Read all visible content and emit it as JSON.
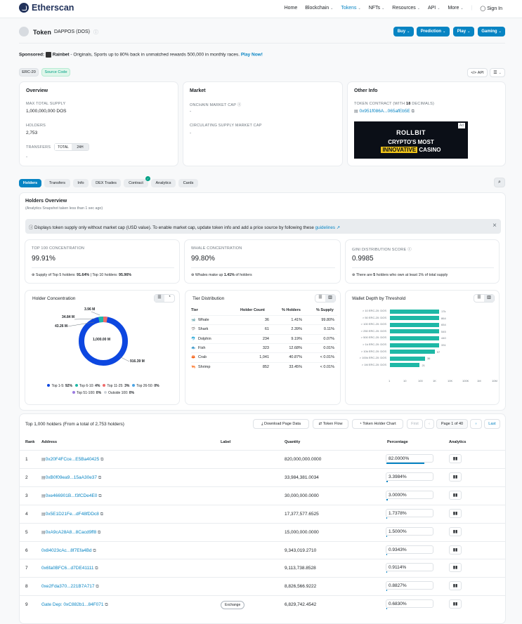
{
  "nav": {
    "brand": "Etherscan",
    "items": [
      "Home",
      "Blockchain",
      "Tokens",
      "NFTs",
      "Resources",
      "API",
      "More"
    ],
    "sign_in": "Sign In"
  },
  "token": {
    "label": "Token",
    "name": "DAPPOS (DOS)"
  },
  "header_buttons": [
    "Buy",
    "Prediction",
    "Play",
    "Gaming"
  ],
  "sponsored": {
    "prefix": "Sponsored:",
    "brand": "Rainbet",
    "text": "- Originals, Sports up to 80% back in unmatched rewards 500,000 in monthly races.",
    "cta": "Play Now!"
  },
  "badges": {
    "std": "ERC-20",
    "source": "Source Code",
    "api": "API"
  },
  "overview": {
    "title": "Overview",
    "max_supply_label": "MAX TOTAL SUPPLY",
    "max_supply": "1,000,000,000 DOS",
    "holders_label": "HOLDERS",
    "holders": "2,753",
    "transfers_label": "TRANSFERS",
    "transfers_total": "TOTAL",
    "transfers_24h": "24H",
    "transfers_val": "-"
  },
  "market": {
    "title": "Market",
    "onchain_label": "ONCHAIN MARKET CAP",
    "onchain": "-",
    "circ_label": "CIRCULATING SUPPLY MARKET CAP",
    "circ": "-"
  },
  "other": {
    "title": "Other Info",
    "contract_label_pre": "TOKEN CONTRACT (WITH ",
    "contract_decimals": "18",
    "contract_label_post": " DECIMALS)",
    "contract": "0x951f086A...065afEb5E",
    "ad_badge": "Ad",
    "ad_logo": "ROLLBIT",
    "ad_line1": "CRYPTO'S MOST",
    "ad_line2a": "INNOVATIVE",
    "ad_line2b": "CASINO"
  },
  "tabs": [
    "Holders",
    "Transfers",
    "Info",
    "DEX Trades",
    "Contract",
    "Analytics",
    "Cards"
  ],
  "holders_overview": {
    "title": "Holders Overview",
    "subtitle": "(Analytics Snapshot taken less than 1 sec ago)",
    "notice": "Displays token supply only without market cap (USD value). To enable market cap, update token info and add a price source by following these",
    "notice_link": "guidelines"
  },
  "stats": [
    {
      "label": "TOP 100 CONCENTRATION",
      "value": "99.91%",
      "note_pre": "Supply of Top 5 holders: ",
      "note_b1": "91.64%",
      "note_mid": " | Top 10 holders: ",
      "note_b2": "95.96%"
    },
    {
      "label": "WHALE CONCENTRATION",
      "value": "99.80%",
      "note_pre": "Whales make up ",
      "note_b1": "1.41%",
      "note_mid": " of holders",
      "note_b2": ""
    },
    {
      "label": "GINI DISTRIBUTION SCORE",
      "value": "0.9985",
      "note_pre": "There are ",
      "note_b1": "5",
      "note_mid": " holders who own at least 1% of total supply",
      "note_b2": ""
    }
  ],
  "concentration": {
    "title": "Holder Concentration",
    "center": "1,000.00 M",
    "labels": [
      "3.96 M",
      "34.84 M",
      "43.26 M",
      "916.39 M"
    ],
    "legend": [
      {
        "name": "Top 1-5:",
        "pct": "92%",
        "color": "#0d47e0"
      },
      {
        "name": "Top 6-10:",
        "pct": "4%",
        "color": "#1eb8a6"
      },
      {
        "name": "Top 11-25:",
        "pct": "3%",
        "color": "#ef6a6a"
      },
      {
        "name": "Top 26-50:",
        "pct": "0%",
        "color": "#4ba3e3"
      },
      {
        "name": "Top 51-100:",
        "pct": "0%",
        "color": "#9c7be0"
      },
      {
        "name": "Outside 100:",
        "pct": "0%",
        "color": "#cfd4da"
      }
    ]
  },
  "tier": {
    "title": "Tier Distribution",
    "headers": [
      "Tier",
      "Holder Count",
      "% Holders",
      "% Supply"
    ],
    "rows": [
      [
        "Whale",
        "36",
        "1.41%",
        "99.80%"
      ],
      [
        "Shark",
        "61",
        "2.39%",
        "0.11%"
      ],
      [
        "Dolphin",
        "234",
        "9.19%",
        "0.07%"
      ],
      [
        "Fish",
        "323",
        "12.68%",
        "0.01%"
      ],
      [
        "Crab",
        "1,041",
        "40.87%",
        "< 0.01%"
      ],
      [
        "Shrimp",
        "852",
        "33.45%",
        "< 0.01%"
      ]
    ]
  },
  "wallet_depth": {
    "title": "Wallet Depth by Threshold",
    "rows": [
      {
        "label": "> 10 ERC-20: DOS",
        "value": 1739,
        "text": "17k"
      },
      {
        "label": "> 50 ERC-20: DOS",
        "value": 864,
        "text": "864"
      },
      {
        "label": "> 100 ERC-20: DOS",
        "value": 654,
        "text": "654"
      },
      {
        "label": "> 250 ERC-20: DOS",
        "value": 545,
        "text": "545"
      },
      {
        "label": "> 500 ERC-20: DOS",
        "value": 440,
        "text": "440"
      },
      {
        "label": "> 1k ERC-20: DOS",
        "value": 331,
        "text": "331"
      },
      {
        "label": "> 10k ERC-20: DOS",
        "value": 97,
        "text": "97"
      },
      {
        "label": "> 100k ERC-20: DOS",
        "value": 36,
        "text": "36"
      },
      {
        "label": "> 1M ERC-20: DOS",
        "value": 21,
        "text": "21"
      }
    ],
    "xticks": [
      "1",
      "10",
      "100",
      "1K",
      "10K",
      "100K",
      "1M",
      "10M"
    ]
  },
  "holders_table": {
    "title": "Top 1,000 holders (From a total of 2,753 holders)",
    "download": "Download Page Data",
    "token_flow": "Token Flow",
    "chart": "Token Holder Chart",
    "first": "First",
    "page": "Page 1 of 40",
    "last": "Last",
    "headers": [
      "Rank",
      "Address",
      "Label",
      "Quantity",
      "Percentage",
      "Analytics"
    ],
    "rows": [
      {
        "rank": "1",
        "address": "0x20F4FCce...E5Ba40425",
        "label": "",
        "qty": "820,000,000.0000",
        "pct": "82.0000%",
        "frac": 0.82,
        "contract": true
      },
      {
        "rank": "2",
        "address": "0xB0f09ea9...15aA30e37",
        "label": "",
        "qty": "33,984,381.0034",
        "pct": "3.3984%",
        "frac": 0.034,
        "contract": true
      },
      {
        "rank": "3",
        "address": "0xe466901B...f3fCDe4E0",
        "label": "",
        "qty": "30,000,000.0000",
        "pct": "3.0000%",
        "frac": 0.03,
        "contract": true
      },
      {
        "rank": "4",
        "address": "0x5E1D21Fe...dF48fDDc8",
        "label": "",
        "qty": "17,377,577.6525",
        "pct": "1.7378%",
        "frac": 0.017,
        "contract": true
      },
      {
        "rank": "5",
        "address": "0xA9cA28A8...8Cacd9ff8",
        "label": "",
        "qty": "15,000,000.0000",
        "pct": "1.5000%",
        "frac": 0.015,
        "contract": true
      },
      {
        "rank": "6",
        "address": "0x84023cAc...8f7Efa4Bd",
        "label": "",
        "qty": "9,343,019.2710",
        "pct": "0.9343%",
        "frac": 0.009,
        "contract": false
      },
      {
        "rank": "7",
        "address": "0x6fa0BFC6...d7DE41111",
        "label": "",
        "qty": "9,113,738.8528",
        "pct": "0.9114%",
        "frac": 0.009,
        "contract": false
      },
      {
        "rank": "8",
        "address": "0xe2Fda370...221B7A717",
        "label": "",
        "qty": "8,826,566.9222",
        "pct": "0.8827%",
        "frac": 0.009,
        "contract": false
      },
      {
        "rank": "9",
        "address": "Gate Dep: 0xC882b1...84F071",
        "label": "Exchange",
        "qty": "6,829,742.4542",
        "pct": "0.6830%",
        "frac": 0.007,
        "contract": false
      }
    ]
  }
}
